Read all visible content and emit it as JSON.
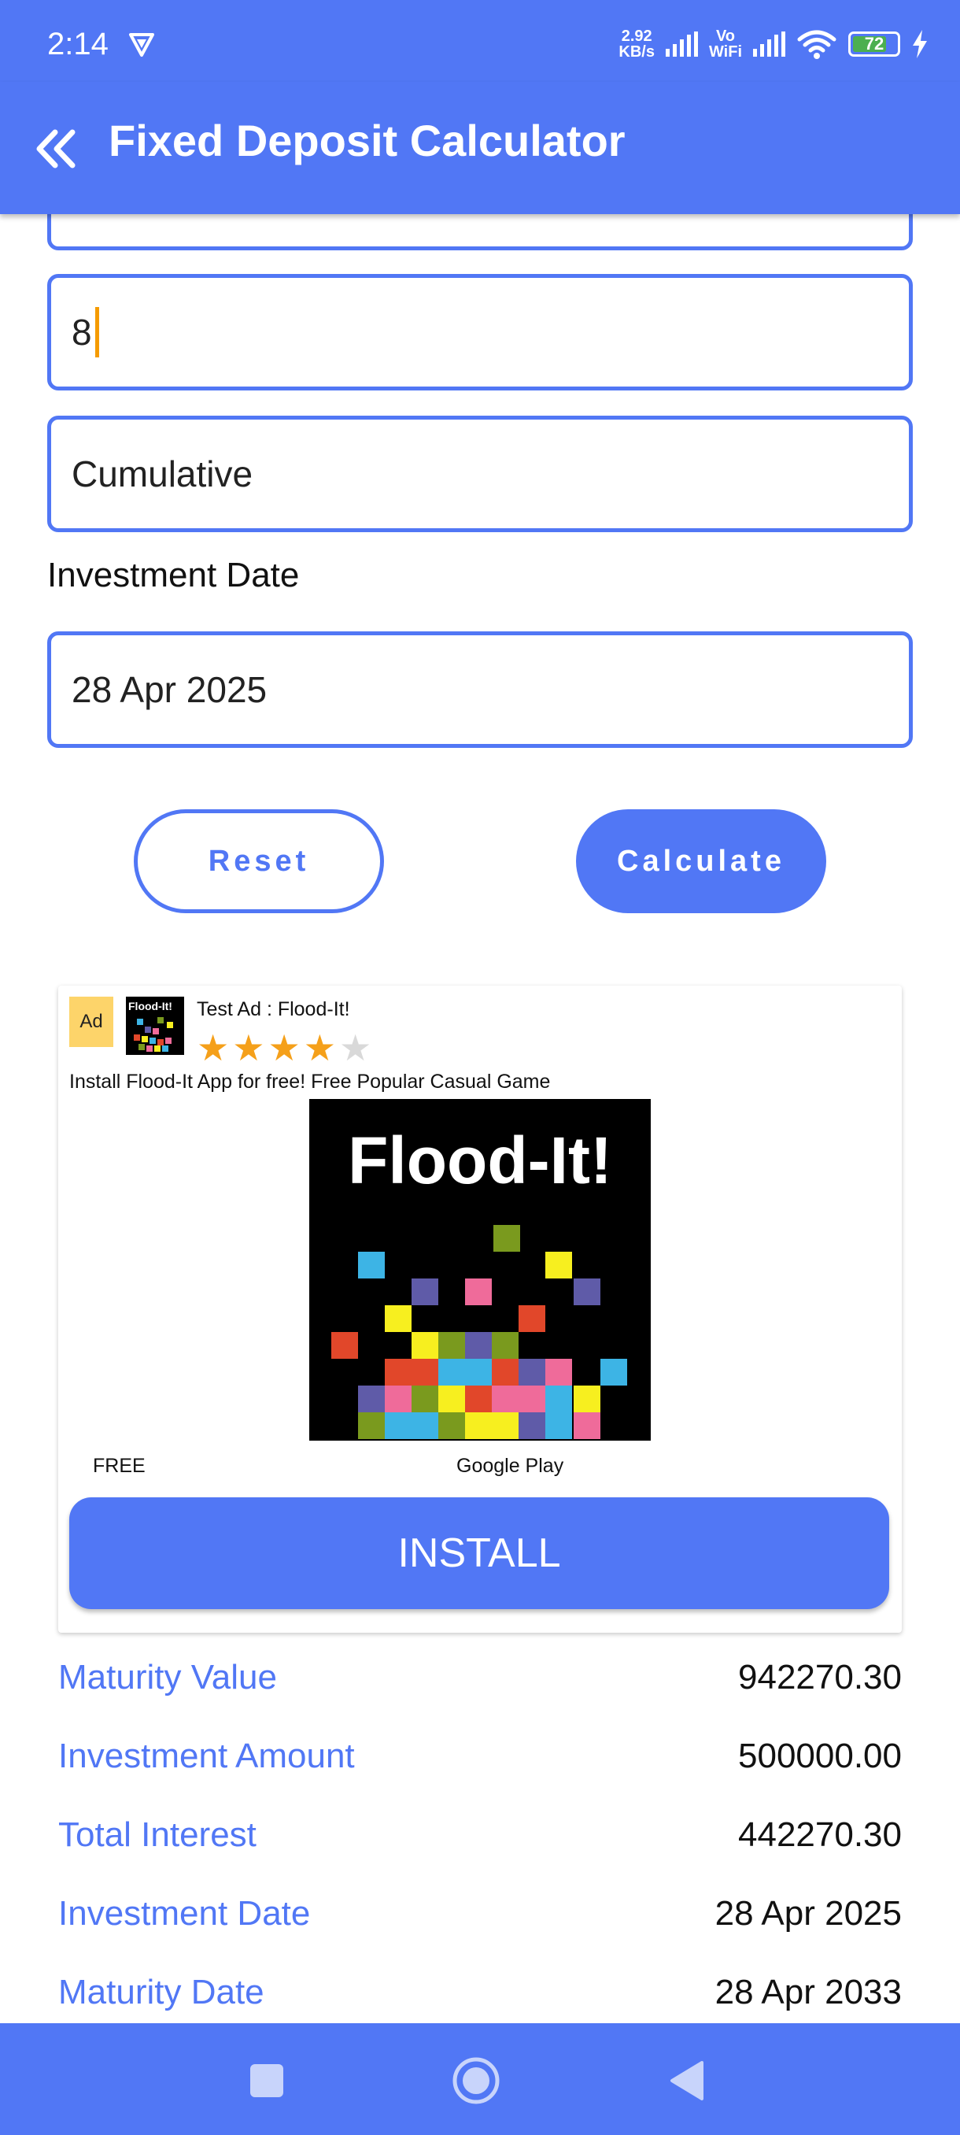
{
  "status_bar": {
    "time": "2:14",
    "net_speed_value": "2.92",
    "net_speed_unit": "KB/s",
    "vowifi_top": "Vo",
    "vowifi_bottom": "WiFi",
    "battery": "72"
  },
  "app_bar": {
    "title": "Fixed Deposit Calculator",
    "back_icon": "double-chevron-left-icon"
  },
  "form": {
    "tenure_value": "8",
    "fd_type_value": "Cumulative",
    "investment_date_label": "Investment Date",
    "investment_date_value": "28 Apr 2025"
  },
  "buttons": {
    "reset": "Reset",
    "calculate": "Calculate"
  },
  "ad": {
    "badge": "Ad",
    "icon_text": "Flood-It!",
    "title": "Test Ad : Flood-It!",
    "rating": 4,
    "rating_max": 5,
    "description": "Install Flood-It App for free! Free Popular Casual Game",
    "image_title": "Flood-It!",
    "price": "FREE",
    "store": "Google Play",
    "install": "INSTALL"
  },
  "results": [
    {
      "label": "Maturity Value",
      "value": "942270.30"
    },
    {
      "label": "Investment Amount",
      "value": "500000.00"
    },
    {
      "label": "Total Interest",
      "value": "442270.30"
    },
    {
      "label": "Investment Date",
      "value": "28 Apr 2025"
    },
    {
      "label": "Maturity Date",
      "value": "28 Apr 2033"
    }
  ],
  "colors": {
    "primary": "#5177f5",
    "caret": "#f59b00",
    "ad_badge": "#fdd46a",
    "star_filled": "#f5a01a",
    "star_empty": "#d9d9d9"
  }
}
